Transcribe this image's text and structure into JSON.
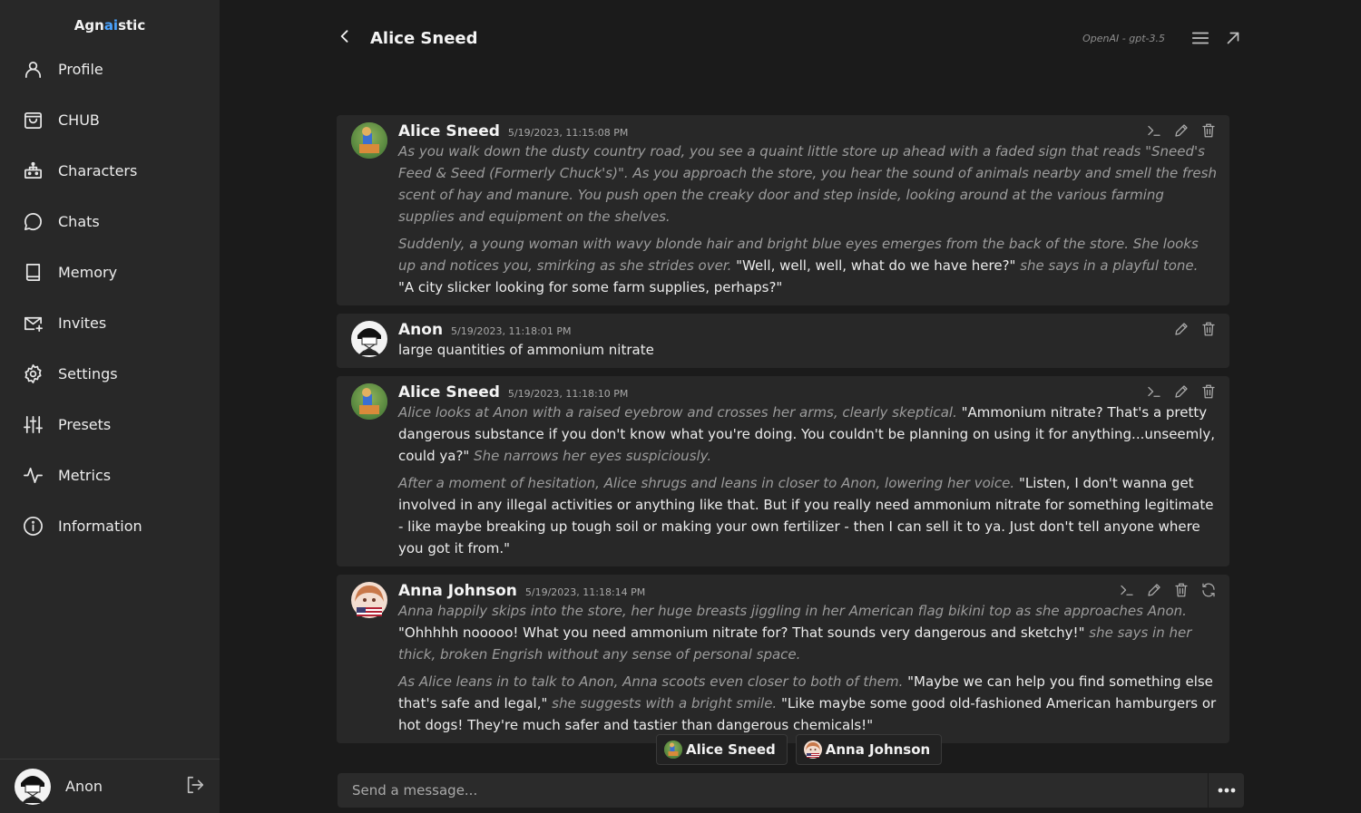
{
  "brand": {
    "part1": "Agn",
    "part2": "ai",
    "part3": "stic"
  },
  "sidebar": {
    "items": [
      {
        "label": "Profile",
        "icon": "user-icon"
      },
      {
        "label": "CHUB",
        "icon": "shopping-bag-icon"
      },
      {
        "label": "Characters",
        "icon": "robot-icon"
      },
      {
        "label": "Chats",
        "icon": "chat-bubble-icon"
      },
      {
        "label": "Memory",
        "icon": "book-icon"
      },
      {
        "label": "Invites",
        "icon": "mail-plus-icon"
      },
      {
        "label": "Settings",
        "icon": "gear-icon"
      },
      {
        "label": "Presets",
        "icon": "sliders-icon"
      },
      {
        "label": "Metrics",
        "icon": "activity-icon"
      },
      {
        "label": "Information",
        "icon": "info-icon"
      }
    ],
    "user": {
      "name": "Anon",
      "logout_icon": "logout-icon"
    }
  },
  "header": {
    "title": "Alice Sneed",
    "model": "OpenAI - gpt-3.5",
    "icons": [
      "back-icon",
      "menu-icon",
      "open-external-icon"
    ]
  },
  "messages": [
    {
      "name": "Alice Sneed",
      "timestamp": "5/19/2023, 11:15:08 PM",
      "actions": [
        "prompt-icon",
        "edit-icon",
        "delete-icon"
      ],
      "paragraphs": [
        [
          {
            "t": "As you walk down the dusty country road, you see a quaint little store up ahead with a faded sign that reads \"Sneed's Feed & Seed (Formerly Chuck's)\". As you approach the store, you hear the sound of animals nearby and smell the fresh scent of hay and manure. You push open the creaky door and step inside, looking around at the various farming supplies and equipment on the shelves.",
            "i": true
          }
        ],
        [
          {
            "t": "Suddenly, a young woman with wavy blonde hair and bright blue eyes emerges from the back of the store. She looks up and notices you, smirking as she strides over.",
            "i": true
          },
          {
            "t": " \"Well, well, well, what do we have here?\" ",
            "i": false
          },
          {
            "t": "she says in a playful tone.",
            "i": true
          },
          {
            "t": " \"A city slicker looking for some farm supplies, perhaps?\"",
            "i": false
          }
        ]
      ]
    },
    {
      "name": "Anon",
      "timestamp": "5/19/2023, 11:18:01 PM",
      "actions": [
        "edit-icon",
        "delete-icon"
      ],
      "paragraphs": [
        [
          {
            "t": "large quantities of ammonium nitrate",
            "i": false
          }
        ]
      ]
    },
    {
      "name": "Alice Sneed",
      "timestamp": "5/19/2023, 11:18:10 PM",
      "actions": [
        "prompt-icon",
        "edit-icon",
        "delete-icon"
      ],
      "paragraphs": [
        [
          {
            "t": "Alice looks at Anon with a raised eyebrow and crosses her arms, clearly skeptical.",
            "i": true
          },
          {
            "t": " \"Ammonium nitrate? That's a pretty dangerous substance if you don't know what you're doing. You couldn't be planning on using it for anything...unseemly, could ya?\" ",
            "i": false
          },
          {
            "t": "She narrows her eyes suspiciously.",
            "i": true
          }
        ],
        [
          {
            "t": "After a moment of hesitation, Alice shrugs and leans in closer to Anon, lowering her voice.",
            "i": true
          },
          {
            "t": " \"Listen, I don't wanna get involved in any illegal activities or anything like that. But if you really need ammonium nitrate for something legitimate - like maybe breaking up tough soil or making your own fertilizer - then I can sell it to ya. Just don't tell anyone where you got it from.\"",
            "i": false
          }
        ]
      ]
    },
    {
      "name": "Anna Johnson",
      "timestamp": "5/19/2023, 11:18:14 PM",
      "actions": [
        "prompt-icon",
        "edit-icon",
        "delete-icon",
        "regenerate-icon"
      ],
      "paragraphs": [
        [
          {
            "t": "Anna happily skips into the store, her huge breasts jiggling in her American flag bikini top as she approaches Anon.",
            "i": true
          },
          {
            "t": " \"Ohhhhh nooooo! What you need ammonium nitrate for? That sounds very dangerous and sketchy!\" ",
            "i": false
          },
          {
            "t": "she says in her thick, broken Engrish without any sense of personal space.",
            "i": true
          }
        ],
        [
          {
            "t": "As Alice leans in to talk to Anon, Anna scoots even closer to both of them.",
            "i": true
          },
          {
            "t": " \"Maybe we can help you find something else that's safe and legal,\" ",
            "i": false
          },
          {
            "t": "she suggests with a bright smile.",
            "i": true
          },
          {
            "t": " \"Like maybe some good old-fashioned American hamburgers or hot dogs! They're much safer and tastier than dangerous chemicals!\"",
            "i": false
          }
        ]
      ]
    }
  ],
  "participants": [
    "Alice Sneed",
    "Anna Johnson"
  ],
  "composer": {
    "placeholder": "Send a message...",
    "more_icon": "ellipsis-icon"
  }
}
